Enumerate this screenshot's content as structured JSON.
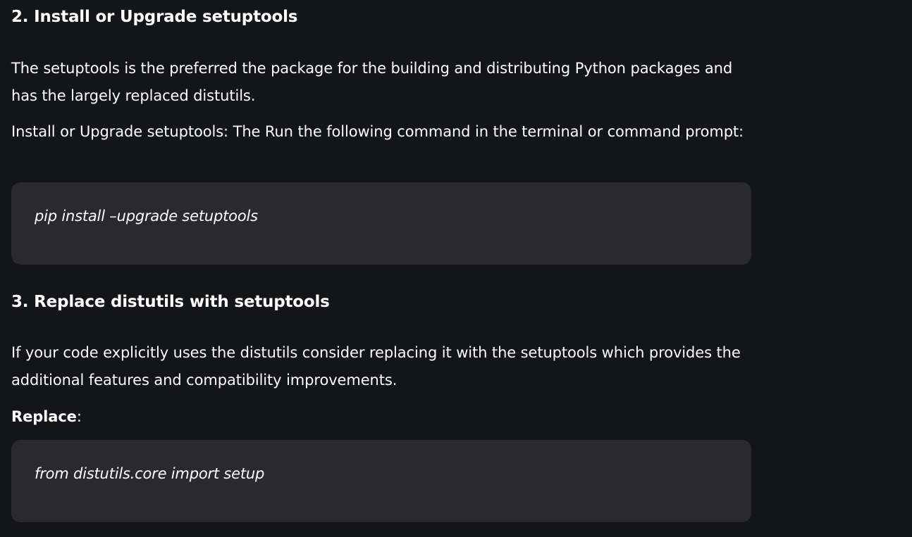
{
  "sections": [
    {
      "heading": "2. Install or Upgrade setuptools",
      "paragraphs": [
        "The setuptools is the preferred the package for the building and distributing Python packages and has the largely replaced distutils.",
        "Install or Upgrade setuptools: The Run the following command in the terminal or command prompt:"
      ],
      "code": "pip install –upgrade setuptools"
    },
    {
      "heading": "3. Replace distutils with setuptools",
      "paragraphs": [
        "If your code explicitly uses the distutils consider replacing it with the setuptools which provides the additional features and compatibility improvements."
      ],
      "label_bold": "Replace",
      "label_suffix": ":",
      "code": "from distutils.core import setup"
    }
  ]
}
